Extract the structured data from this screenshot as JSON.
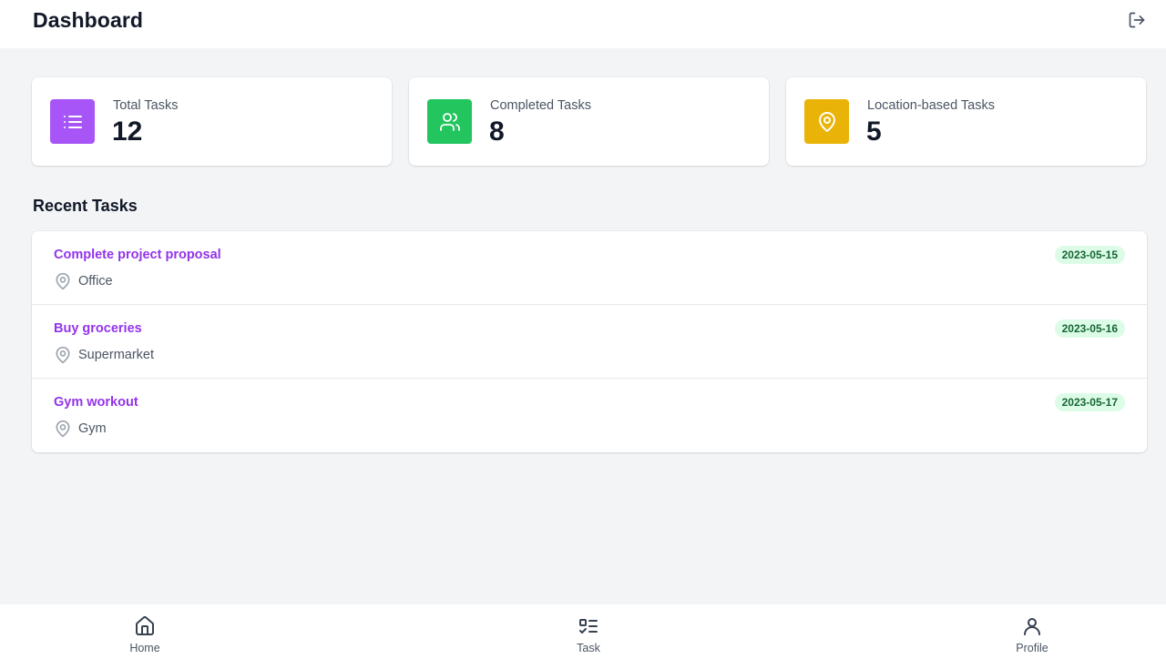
{
  "header": {
    "title": "Dashboard",
    "logout_icon": "logout-icon"
  },
  "stats": [
    {
      "label": "Total Tasks",
      "value": "12",
      "icon": "list-icon",
      "color": "#a855f7"
    },
    {
      "label": "Completed Tasks",
      "value": "8",
      "icon": "users-icon",
      "color": "#22c55e"
    },
    {
      "label": "Location-based Tasks",
      "value": "5",
      "icon": "map-pin-icon",
      "color": "#eab308"
    }
  ],
  "recent": {
    "title": "Recent Tasks",
    "tasks": [
      {
        "title": "Complete project proposal",
        "location": "Office",
        "date": "2023-05-15"
      },
      {
        "title": "Buy groceries",
        "location": "Supermarket",
        "date": "2023-05-16"
      },
      {
        "title": "Gym workout",
        "location": "Gym",
        "date": "2023-05-17"
      }
    ]
  },
  "nav": {
    "items": [
      {
        "label": "Home",
        "icon": "home-icon"
      },
      {
        "label": "Task",
        "icon": "task-list-icon"
      },
      {
        "label": "Profile",
        "icon": "user-icon"
      }
    ]
  },
  "colors": {
    "accent": "#9333ea",
    "badge_bg": "#dcfce7",
    "badge_text": "#166534",
    "background": "#f3f4f6"
  }
}
